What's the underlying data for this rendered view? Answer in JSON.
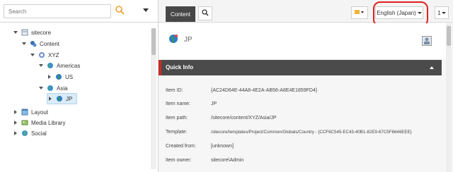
{
  "search": {
    "placeholder": "Search"
  },
  "tree": {
    "nodes": [
      {
        "label": "sitecore"
      },
      {
        "label": "Content"
      },
      {
        "label": "XYZ"
      },
      {
        "label": "Americas"
      },
      {
        "label": "US"
      },
      {
        "label": "Asia"
      },
      {
        "label": "JP"
      },
      {
        "label": "Layout"
      },
      {
        "label": "Media Library"
      },
      {
        "label": "Social"
      }
    ]
  },
  "toolbar": {
    "content_tab": "Content",
    "language": "English (Japan)",
    "version": "1"
  },
  "item": {
    "title": "JP"
  },
  "quick_info": {
    "title": "Quick Info",
    "rows": [
      {
        "key": "Item ID:",
        "value": "{AC24D64E-44A8-4E2A-AB56-A8E4E1859FD4}"
      },
      {
        "key": "Item name:",
        "value": "JP"
      },
      {
        "key": "Item path:",
        "value": "/sitecore/content/XYZ/Asia/JP"
      },
      {
        "key": "Template:",
        "value": "/sitecore/templates/Project/Common/Globals/Country - {CCF6C545-EC43-40B1-82E9-67C5F6646EEE}"
      },
      {
        "key": "Created from:",
        "value": "[unknown]"
      },
      {
        "key": "Item owner:",
        "value": "sitecore\\Admin"
      }
    ]
  },
  "colors": {
    "accent": "#c92b24",
    "quick_info_bar": "#4b4b4b",
    "highlight_circle": "#e02020",
    "selected_node": "#d9ecf8"
  }
}
